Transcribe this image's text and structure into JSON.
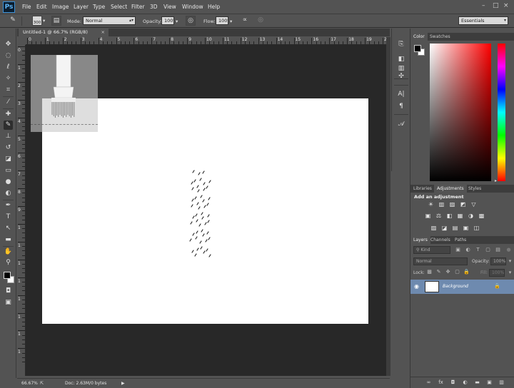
{
  "menubar": {
    "logo": "Ps",
    "items": [
      "File",
      "Edit",
      "Image",
      "Layer",
      "Type",
      "Select",
      "Filter",
      "3D",
      "View",
      "Window",
      "Help"
    ],
    "window_controls": [
      "–",
      "□",
      "×"
    ]
  },
  "options": {
    "brush_size": "300",
    "mode_label": "Mode:",
    "mode_value": "Normal",
    "opacity_label": "Opacity:",
    "opacity_value": "100%",
    "flow_label": "Flow:",
    "flow_value": "100%",
    "workspace": "Essentials"
  },
  "tools": {
    "icons": [
      "move-icon",
      "marquee-icon",
      "lasso-icon",
      "quick-select-icon",
      "crop-icon",
      "eyedropper-icon",
      "healing-icon",
      "brush-icon",
      "stamp-icon",
      "history-brush-icon",
      "eraser-icon",
      "gradient-icon",
      "blur-icon",
      "dodge-icon",
      "pen-icon",
      "type-icon",
      "path-select-icon",
      "rectangle-icon",
      "hand-icon",
      "zoom-icon"
    ],
    "active": "brush-icon",
    "foreground_color": "#000000",
    "background_color": "#ffffff"
  },
  "document": {
    "tab_title": "Untitled-1 @ 66.7% (RGB/8)",
    "ruler_h_labels": [
      "0",
      "1",
      "2",
      "3",
      "4",
      "5",
      "6",
      "7",
      "8",
      "9",
      "10",
      "11",
      "12",
      "13",
      "14",
      "15",
      "16",
      "17",
      "18",
      "19",
      "20"
    ],
    "ruler_v_labels": [
      "0",
      "1",
      "2",
      "3",
      "4",
      "5",
      "6",
      "7",
      "8",
      "9",
      "1",
      "1",
      "1",
      "1",
      "1",
      "1",
      "1",
      "1"
    ]
  },
  "status": {
    "zoom": "66.67%",
    "doc_info": "Doc: 2.63M/0 bytes"
  },
  "panels": {
    "color_tabs": [
      "Color",
      "Swatches"
    ],
    "adjust_tabs": [
      "Libraries",
      "Adjustments",
      "Styles"
    ],
    "adjust_title": "Add an adjustment",
    "layers_tabs": [
      "Layers",
      "Channels",
      "Paths"
    ],
    "kind_label": "Kind",
    "blend_mode": "Normal",
    "opacity_label": "Opacity:",
    "opacity_value": "100%",
    "lock_label": "Lock:",
    "fill_label": "Fill:",
    "fill_value": "100%",
    "layer_name": "Background"
  },
  "colors": {
    "ui_bg": "#535353",
    "canvas_bg": "#282828",
    "selected_layer": "#6e8aaf",
    "accent": "#3a8fd6"
  }
}
